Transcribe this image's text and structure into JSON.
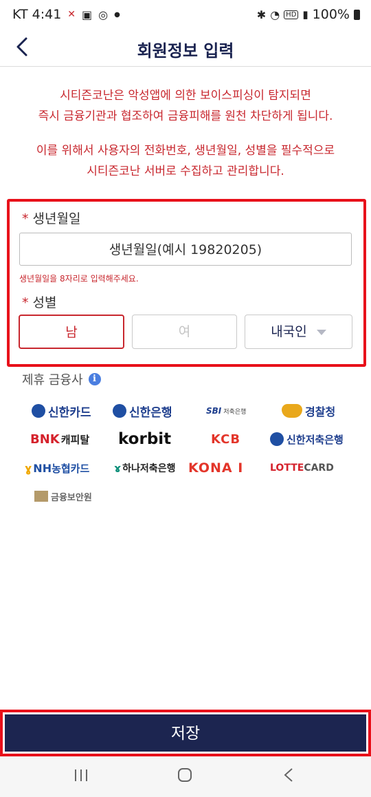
{
  "status_bar": {
    "carrier_time": "KT 4:41",
    "battery": "100%",
    "hd": "HD"
  },
  "header": {
    "title": "회원정보 입력"
  },
  "notice": {
    "line1": "시티즌코난은 악성앱에 의한 보이스피싱이 탐지되면",
    "line2": "즉시 금융기관과 협조하여 금융피해를 원천 차단하게 됩니다.",
    "line3": "이를 위해서 사용자의 전화번호, 생년월일, 성별을 필수적으로",
    "line4": "시티즌코난 서버로 수집하고 관리합니다."
  },
  "form": {
    "required_mark": "*",
    "birth_label": "생년월일",
    "birth_placeholder": "생년월일(예시 19820205)",
    "birth_hint": "생년월일을 8자리로 입력해주세요.",
    "gender_label": "성별",
    "male": "남",
    "female": "여",
    "nationality": "내국인",
    "selected_gender": "male"
  },
  "partners": {
    "title": "제휴 금융사",
    "logos": [
      {
        "name": "shinhan-card",
        "text": "신한카드"
      },
      {
        "name": "shinhan-bank",
        "text": "신한은행"
      },
      {
        "name": "sbi-savings",
        "text": "SBI",
        "sub": "저축은행"
      },
      {
        "name": "police",
        "text": "경찰청"
      },
      {
        "name": "bnk-capital",
        "text": "BNK",
        "sub": "캐피탈"
      },
      {
        "name": "korbit",
        "text": "korbit"
      },
      {
        "name": "kcb",
        "text": "KCB"
      },
      {
        "name": "shinhan-savings",
        "text": "신한저축은행"
      },
      {
        "name": "nh-card",
        "text": "NH",
        "sub": "농협카드"
      },
      {
        "name": "hana-savings",
        "text": "하나저축은행"
      },
      {
        "name": "kona-i",
        "text": "KONA I"
      },
      {
        "name": "lotte-card",
        "text": "LOTTE",
        "sub": "CARD"
      },
      {
        "name": "fsi",
        "text": "금융보안원"
      }
    ]
  },
  "footer": {
    "save_label": "저장"
  },
  "colors": {
    "navy": "#1c2550",
    "red": "#c8272e",
    "highlight": "#e8101a"
  }
}
